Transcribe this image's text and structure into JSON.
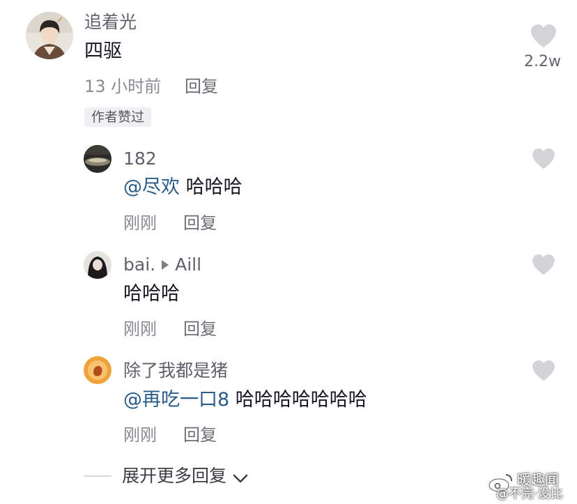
{
  "main_comment": {
    "username": "追着光",
    "text": "四驱",
    "time": "13 小时前",
    "reply_label": "回复",
    "badge": "作者赞过",
    "like_count": "2.2w"
  },
  "replies": [
    {
      "username": "182",
      "mention": "@尽欢",
      "text": "哈哈哈",
      "time": "刚刚",
      "reply_label": "回复"
    },
    {
      "username": "bai.",
      "reply_to": "Aill",
      "text": "哈哈哈",
      "time": "刚刚",
      "reply_label": "回复"
    },
    {
      "username": "除了我都是猪",
      "mention": "@再吃一口8",
      "text": "哈哈哈哈哈哈哈",
      "time": "刚刚",
      "reply_label": "回复"
    }
  ],
  "expand_more": {
    "label": "展开更多回复"
  },
  "watermark": {
    "line1": "暖趣闻",
    "line2": "@不完·没比"
  },
  "icons": {
    "like": "heart-icon",
    "reply_arrow": "play-arrow-icon",
    "expand": "chevron-down-icon",
    "watermark": "weibo-logo-icon"
  },
  "colors": {
    "mention": "#2a5c8a",
    "heart": "#d4d4d8",
    "meta": "#8a8b91"
  }
}
